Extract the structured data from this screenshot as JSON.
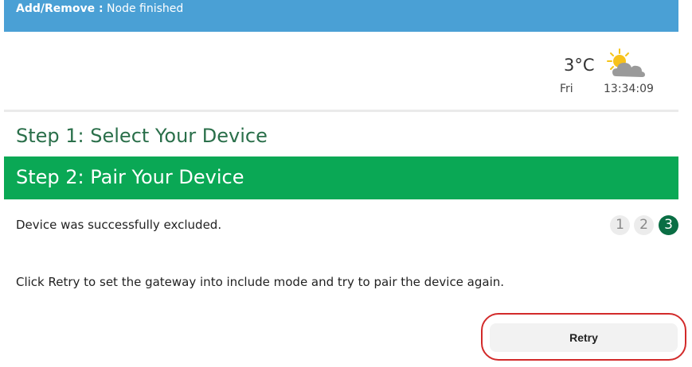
{
  "notification": {
    "label": "Add/Remove :",
    "message": " Node finished"
  },
  "weather": {
    "temperature": "3°C",
    "day": "Fri",
    "time": "13:34:09",
    "icon": "partly-cloudy-icon"
  },
  "steps": {
    "step1_title": "Step 1: Select Your Device",
    "step2_title": "Step 2: Pair Your Device"
  },
  "status": {
    "message": "Device was successfully excluded."
  },
  "pager": {
    "pages": [
      "1",
      "2",
      "3"
    ],
    "active_page": 3
  },
  "instruction": {
    "text": "Click Retry to set the gateway into include mode and try to pair the device again."
  },
  "retry": {
    "label": "Retry"
  },
  "colors": {
    "notification_bar": "#4aa0d5",
    "step_active": "#0aa855",
    "step_inactive_text": "#2a6f4a",
    "pager_active": "#0a6e44",
    "highlight": "#d22a2a"
  }
}
